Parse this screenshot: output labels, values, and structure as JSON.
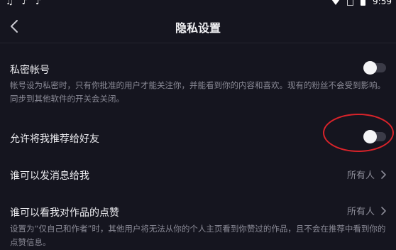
{
  "status_bar": {
    "left_glyphs": "♫ ♪ ♪",
    "time": "9:59"
  },
  "header": {
    "title": "隐私设置",
    "back_icon": "chevron-left-icon"
  },
  "settings": {
    "private_account": {
      "title": "私密帐号",
      "description": "帐号设为私密时，只有你批准的用户才能关注你，并能看到你的内容和喜欢。现有的粉丝不会受到影响。同步到其他软件的开关会关闭。",
      "enabled": false
    },
    "recommend_to_friends": {
      "title": "允许将我推荐给好友",
      "enabled": false
    },
    "who_can_message": {
      "title": "谁可以发消息给我",
      "value": "所有人"
    },
    "who_can_see_likes": {
      "title": "谁可以看我对作品的点赞",
      "value": "所有人",
      "description": "设置为“仅自己和作者”时，其他用户将无法从你的个人主页看到你赞过的作品，且不会在推荐中看到你的点赞信息。"
    }
  },
  "colors": {
    "background": "#15151f",
    "annotation": "#d8232a",
    "toggle_off": "#3b3b47"
  }
}
